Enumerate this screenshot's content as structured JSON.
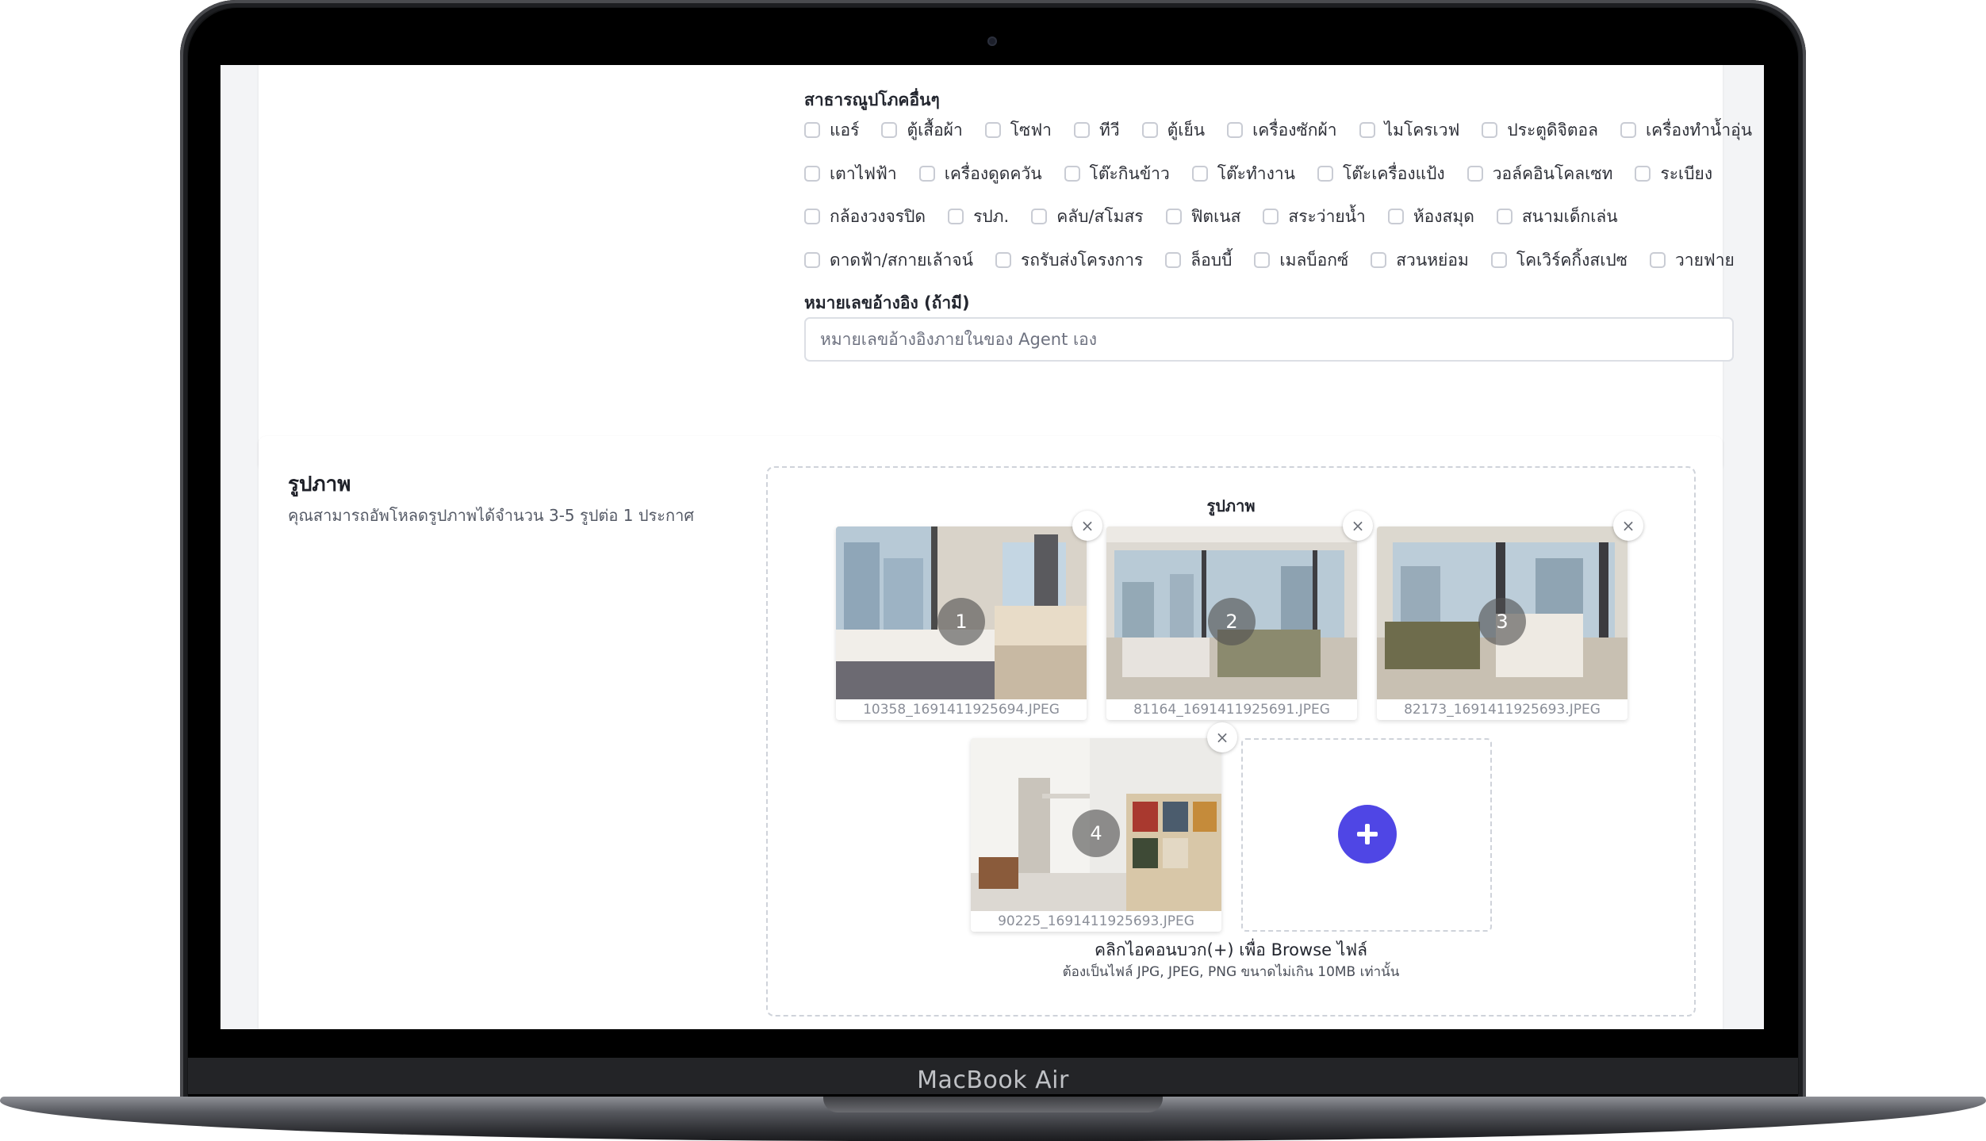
{
  "device": {
    "brand_label": "MacBook Air"
  },
  "amenities": {
    "title": "สาธารณูปโภคอื่นๆ",
    "rows": [
      [
        "แอร์",
        "ตู้เสื้อผ้า",
        "โซฟา",
        "ทีวี",
        "ตู้เย็น",
        "เครื่องซักผ้า",
        "ไมโครเวฟ",
        "ประตูดิจิตอล",
        "เครื่องทำน้ำอุ่น"
      ],
      [
        "เตาไฟฟ้า",
        "เครื่องดูดควัน",
        "โต๊ะกินข้าว",
        "โต๊ะทำงาน",
        "โต๊ะเครื่องแป้ง",
        "วอล์คอินโคลเซท",
        "ระเบียง"
      ],
      [
        "กล้องวงจรปิด",
        "รปภ.",
        "คลับ/สโมสร",
        "ฟิตเนส",
        "สระว่ายน้ำ",
        "ห้องสมุด",
        "สนามเด็กเล่น"
      ],
      [
        "ดาดฟ้า/สกายเล้าจน์",
        "รถรับส่งโครงการ",
        "ล็อบบี้",
        "เมลบ็อกซ์",
        "สวนหย่อม",
        "โคเวิร์คกิ้งสเปซ",
        "วายฟาย"
      ]
    ]
  },
  "reference": {
    "label": "หมายเลขอ้างอิง (ถ้ามี)",
    "placeholder": "หมายเลขอ้างอิงภายในของ Agent เอง",
    "value": ""
  },
  "photos": {
    "title": "รูปภาพ",
    "description": "คุณสามารถอัพโหลดรูปภาพได้จำนวน 3-5 รูปต่อ 1 ประกาศ",
    "dropzone_title": "รูปภาพ",
    "items": [
      {
        "number": "1",
        "filename": "10358_1691411925694.JPEG",
        "remove_label": "×"
      },
      {
        "number": "2",
        "filename": "81164_1691411925691.JPEG",
        "remove_label": "×"
      },
      {
        "number": "3",
        "filename": "82173_1691411925693.JPEG",
        "remove_label": "×"
      },
      {
        "number": "4",
        "filename": "90225_1691411925693.JPEG",
        "remove_label": "×"
      }
    ],
    "add_icon": "plus-icon",
    "hint_main": "คลิกไอคอนบวก(+) เพื่อ Browse ไฟล์",
    "hint_sub": "ต้องเป็นไฟล์ JPG, JPEG, PNG ขนาดไม่เกิน 10MB เท่านั้น"
  },
  "colors": {
    "accent": "#4f46e5",
    "page_bg": "#f3f4f6"
  }
}
